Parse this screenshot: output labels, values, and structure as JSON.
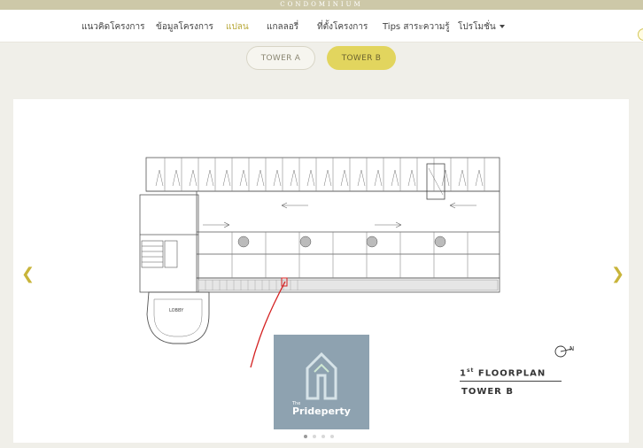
{
  "header": {
    "brand": "CONDOMINIUM"
  },
  "nav": {
    "items": [
      {
        "label": "แนวคิดโครงการ"
      },
      {
        "label": "ข้อมูลโครงการ"
      },
      {
        "label": "แปลน"
      },
      {
        "label": "แกลลอรี่"
      },
      {
        "label": "ที่ตั้งโครงการ"
      },
      {
        "label": "Tips สาระความรู้"
      },
      {
        "label": "โปรโมชั่น"
      }
    ],
    "active_index": 2
  },
  "tabs": [
    {
      "label": "TOWER A",
      "selected": false
    },
    {
      "label": "TOWER B",
      "selected": true
    }
  ],
  "plan": {
    "lobby_label": "LOBBY",
    "north_label": "N",
    "floor_number": "1",
    "floor_suffix": "st",
    "floor_text": "FLOORPLAN",
    "tower_label": "TOWER B"
  },
  "watermark": {
    "small": "The",
    "name": "Prideperty"
  },
  "carousel": {
    "slide_count": 4,
    "active_slide": 1
  },
  "colors": {
    "accent": "#e2d55e",
    "active_nav": "#b8a93a",
    "arrow": "#c8b43a",
    "annotation": "#d42020"
  }
}
